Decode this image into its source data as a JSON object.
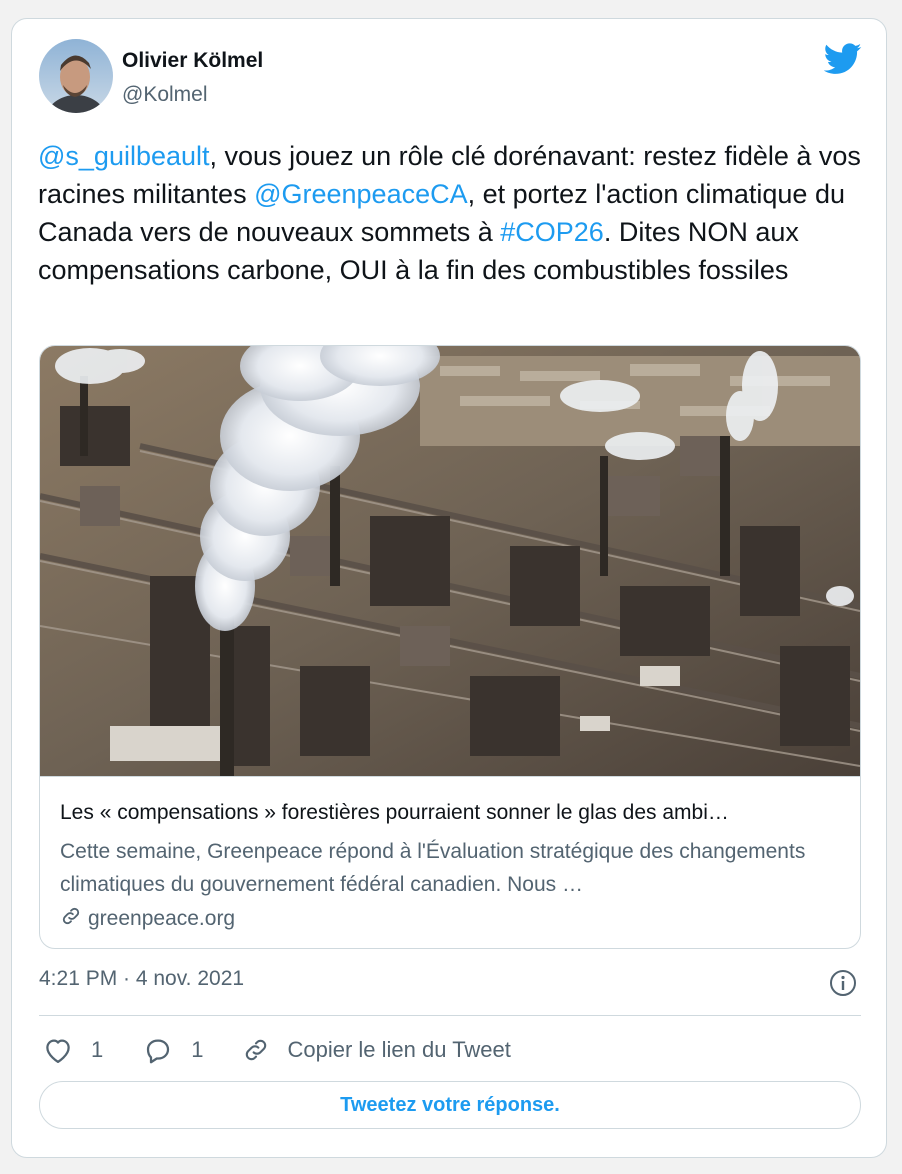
{
  "author": {
    "name": "Olivier Kölmel",
    "handle": "@Kolmel"
  },
  "tweet": {
    "mention1": "@s_guilbeault",
    "text1": ", vous jouez un rôle clé dorénavant: restez fidèle à vos racines militantes ",
    "mention2": "@GreenpeaceCA",
    "text2": ", et portez l'action climatique du Canada vers de nouveaux sommets à ",
    "hashtag": "#COP26",
    "text3": ". Dites NON aux compensations carbone, OUI à la fin des combustibles fossiles"
  },
  "link_card": {
    "title": "Les « compensations » forestières pourraient sonner le glas des ambi…",
    "description": "Cette semaine, Greenpeace répond à l'Évaluation stratégique des changements climatiques du gouvernement fédéral canadien. Nous …",
    "domain": "greenpeace.org"
  },
  "timestamp": "4:21 PM · 4 nov. 2021",
  "actions": {
    "like_count": "1",
    "reply_count": "1",
    "copy_link_label": "Copier le lien du Tweet"
  },
  "reply_button_label": "Tweetez votre réponse.",
  "colors": {
    "accent": "#1d9bf0",
    "text_primary": "#0f1419",
    "text_secondary": "#536471",
    "border": "#cfd9de"
  }
}
